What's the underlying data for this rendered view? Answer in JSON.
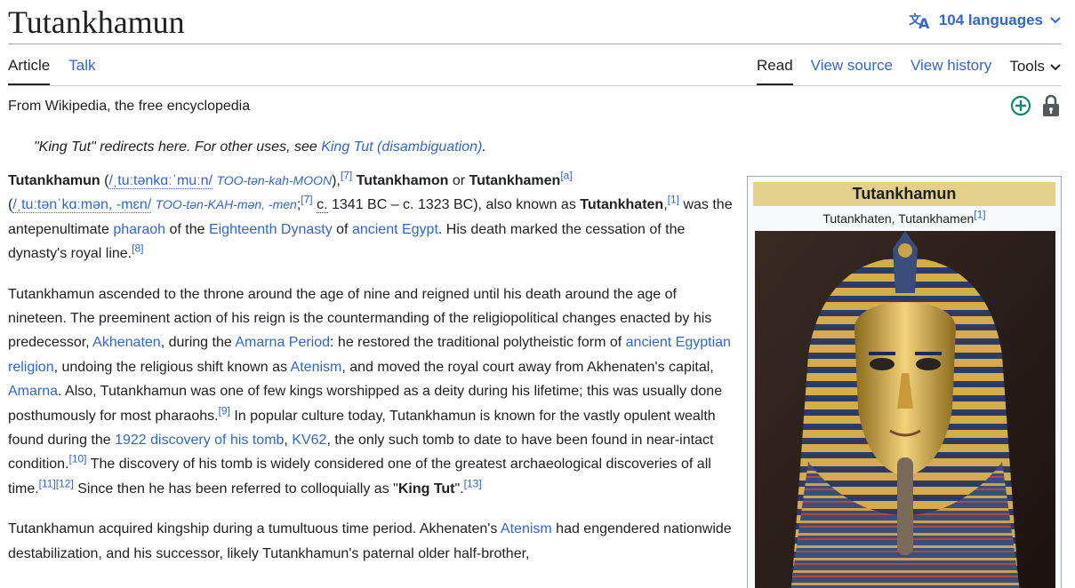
{
  "page": {
    "title": "Tutankhamun",
    "languages_label": "104 languages"
  },
  "tabs": {
    "article": "Article",
    "talk": "Talk",
    "read": "Read",
    "view_source": "View source",
    "view_history": "View history",
    "tools": "Tools"
  },
  "tagline": "From Wikipedia, the free encyclopedia",
  "hatnote": {
    "prefix": "\"King Tut\" redirects here. For other uses, see ",
    "link": "King Tut (disambiguation)",
    "suffix": "."
  },
  "para1": {
    "s1": "Tutankhamun",
    "s2": " (",
    "ipa1": "/ˌtuːtənkɑːˈmuːn/",
    "resp1": "TOO-tən-kah-MOON",
    "s3": "),",
    "ref1": "[7]",
    "s4": " ",
    "s5": "Tutankhamon",
    "s6": " or ",
    "s7": "Tutankhamen",
    "ref2": "[a]",
    "s8": " (",
    "ipa2": "/ˌtuːtənˈkɑːmən, -mɛn/",
    "resp2": "TOO-tən-KAH-mən, -men",
    "s9": ";",
    "ref3": "[7]",
    "circa": "c.",
    "s10": " 1341 BC – c. 1323 BC), also known as ",
    "s11": "Tutankhaten",
    "s12": ",",
    "ref4": "[1]",
    "s13": " was the antepenultimate ",
    "l1": "pharaoh",
    "s14": " of the ",
    "l2": "Eighteenth Dynasty",
    "s15": " of ",
    "l3": "ancient Egypt",
    "s16": ". His death marked the cessation of the dynasty's royal line.",
    "ref5": "[8]"
  },
  "para2": {
    "s1": "Tutankhamun ascended to the throne around the age of nine and reigned until his death around the age of nineteen. The preeminent action of his reign is the countermanding of the religiopolitical changes enacted by his predecessor, ",
    "l1": "Akhenaten",
    "s2": ", during the ",
    "l2": "Amarna Period",
    "s3": ": he restored the traditional polytheistic form of ",
    "l3": "ancient Egyptian religion",
    "s4": ", undoing the religious shift known as ",
    "l4": "Atenism",
    "s5": ", and moved the royal court away from Akhenaten's capital, ",
    "l5": "Amarna",
    "s6": ". Also, Tutankhamun was one of few kings worshipped as a deity during his lifetime; this was usually done posthumously for most pharaohs.",
    "ref1": "[9]",
    "s7": " In popular culture today, Tutankhamun is known for the vastly opulent wealth found during the ",
    "l6": "1922 discovery of his tomb",
    "s8": ", ",
    "l7": "KV62",
    "s9": ", the only such tomb to date to have been found in near-intact condition.",
    "ref2": "[10]",
    "s10": " The discovery of his tomb is widely considered one of the greatest archaeological discoveries of all time.",
    "ref3": "[11]",
    "ref4": "[12]",
    "s11": " Since then he has been referred to colloquially as \"",
    "s12": "King Tut",
    "s13": "\".",
    "ref5": "[13]"
  },
  "para3": {
    "s1": "Tutankhamun acquired kingship during a tumultuous time period. Akhenaten's ",
    "l1": "Atenism",
    "s2": " had engendered nationwide destabilization, and his successor, likely Tutankhamun's paternal older half-brother,"
  },
  "infobox": {
    "title": "Tutankhamun",
    "subtitle": "Tutankhaten, Tutankhamen",
    "sub_ref": "[1]"
  },
  "colors": {
    "link": "#3366cc",
    "infobox_header": "#e3d08b",
    "text": "#202122"
  }
}
